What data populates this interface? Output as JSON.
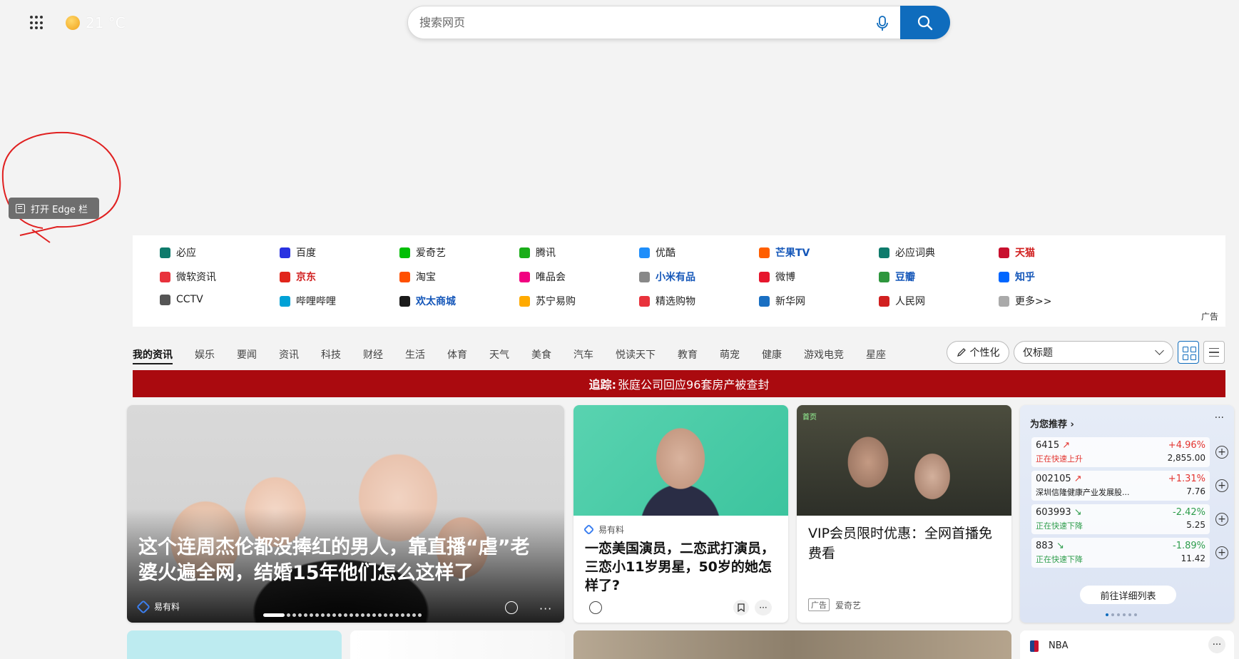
{
  "header": {
    "temperature": "21 °C",
    "search_placeholder": "搜索网页"
  },
  "edge_bar": {
    "label": "打开 Edge 栏"
  },
  "quick_links": {
    "ad_label": "广告",
    "items": [
      {
        "label": "必应",
        "icon": "bing-icon",
        "color": "#0f7b6c",
        "style": "normal"
      },
      {
        "label": "百度",
        "icon": "baidu-icon",
        "color": "#2932e1",
        "style": "normal"
      },
      {
        "label": "爱奇艺",
        "icon": "iqiyi-icon",
        "color": "#00be06",
        "style": "normal"
      },
      {
        "label": "腾讯",
        "icon": "tencent-icon",
        "color": "#1aad19",
        "style": "normal"
      },
      {
        "label": "优酷",
        "icon": "youku-icon",
        "color": "#1f8efa",
        "style": "normal"
      },
      {
        "label": "芒果TV",
        "icon": "mangotv-icon",
        "color": "#ff5f00",
        "style": "bold"
      },
      {
        "label": "必应词典",
        "icon": "bing-dict-icon",
        "color": "#0f7b6c",
        "style": "normal"
      },
      {
        "label": "天猫",
        "icon": "tmall-icon",
        "color": "#c8102e",
        "style": "red"
      },
      {
        "label": "微软资讯",
        "icon": "msn-icon",
        "color": "#e8323c",
        "style": "normal"
      },
      {
        "label": "京东",
        "icon": "jd-icon",
        "color": "#e1251b",
        "style": "red"
      },
      {
        "label": "淘宝",
        "icon": "taobao-icon",
        "color": "#ff5000",
        "style": "normal"
      },
      {
        "label": "唯品会",
        "icon": "vip-icon",
        "color": "#f10180",
        "style": "normal"
      },
      {
        "label": "小米有品",
        "icon": "xiaomi-youpin-icon",
        "color": "#888888",
        "style": "bold"
      },
      {
        "label": "微博",
        "icon": "weibo-icon",
        "color": "#e6162d",
        "style": "normal"
      },
      {
        "label": "豆瓣",
        "icon": "douban-icon",
        "color": "#2e963d",
        "style": "bold"
      },
      {
        "label": "知乎",
        "icon": "zhihu-icon",
        "color": "#0066ff",
        "style": "bold"
      },
      {
        "label": "CCTV",
        "icon": "cctv-icon",
        "color": "#555555",
        "style": "normal"
      },
      {
        "label": "哔哩哔哩",
        "icon": "bilibili-icon",
        "color": "#00a1d6",
        "style": "normal"
      },
      {
        "label": "欢太商城",
        "icon": "heytap-icon",
        "color": "#1a1a1a",
        "style": "bold"
      },
      {
        "label": "苏宁易购",
        "icon": "suning-icon",
        "color": "#ffaa00",
        "style": "normal"
      },
      {
        "label": "精选购物",
        "icon": "shopping-icon",
        "color": "#e8323c",
        "style": "normal"
      },
      {
        "label": "新华网",
        "icon": "xinhua-icon",
        "color": "#1a6fc2",
        "style": "normal"
      },
      {
        "label": "人民网",
        "icon": "people-icon",
        "color": "#d12020",
        "style": "normal"
      },
      {
        "label": "更多>>",
        "icon": "more-icon",
        "color": "#aaaaaa",
        "style": "normal"
      }
    ]
  },
  "tabs": [
    "我的资讯",
    "娱乐",
    "要闻",
    "资讯",
    "科技",
    "财经",
    "生活",
    "体育",
    "天气",
    "美食",
    "汽车",
    "悦读天下",
    "教育",
    "萌宠",
    "健康",
    "游戏电竞",
    "星座"
  ],
  "toolbar": {
    "personalize": "个性化",
    "view_select": "仅标题"
  },
  "banner": {
    "prefix": "追踪:",
    "text": "张庭公司回应96套房产被查封"
  },
  "cards": {
    "hero": {
      "title": "这个连周杰伦都没捧红的男人，靠直播“虐”老婆火遍全网，结婚15年他们怎么这样了",
      "source": "易有料"
    },
    "c2": {
      "source": "易有料",
      "title": "一恋美国演员，二恋武打演员，三恋小11岁男星，50岁的她怎样了?"
    },
    "c3": {
      "title": "VIP会员限时优惠：全网首播免费看",
      "ad": "广告",
      "source": "爱奇艺",
      "overlay": "首页"
    },
    "stocks": {
      "header": "为您推荐",
      "detail_button": "前往详细列表",
      "items": [
        {
          "code": "6415",
          "desc": "正在快速上升",
          "pct": "+4.96%",
          "price": "2,855.00",
          "dir": "up"
        },
        {
          "code": "002105",
          "desc": "深圳信隆健康产业发展股...",
          "pct": "+1.31%",
          "price": "7.76",
          "dir": "up"
        },
        {
          "code": "603993",
          "desc": "正在快速下降",
          "pct": "-2.42%",
          "price": "5.25",
          "dir": "down"
        },
        {
          "code": "883",
          "desc": "正在快速下降",
          "pct": "-1.89%",
          "price": "11.42",
          "dir": "down"
        }
      ]
    },
    "nba": {
      "label": "NBA"
    }
  }
}
